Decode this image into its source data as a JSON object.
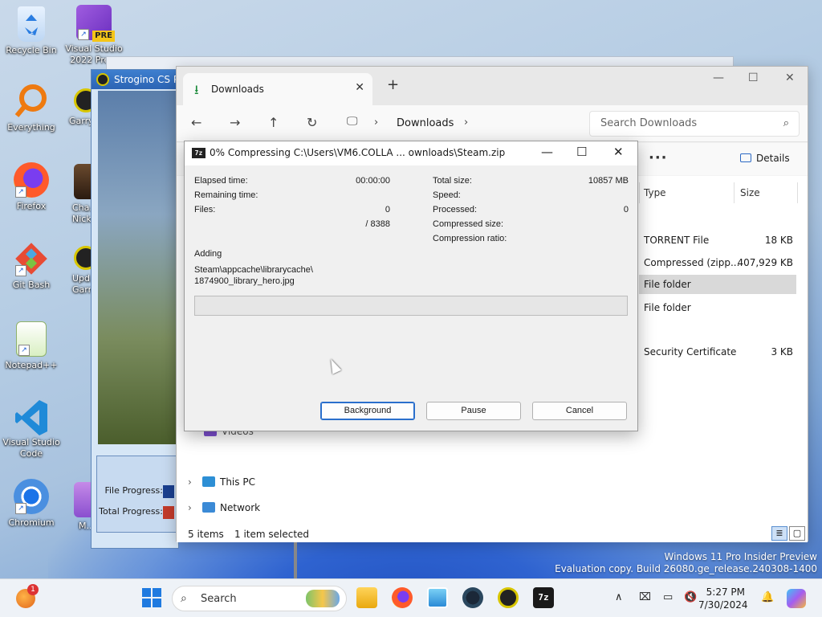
{
  "desktop": {
    "icons": [
      {
        "label": "Recycle Bin",
        "icon": "recycle-bin-icon"
      },
      {
        "label": "Visual Studio 2022 Pre...",
        "icon": "visual-studio-icon",
        "badge": "PRE"
      },
      {
        "label": "Everything",
        "icon": "everything-search-icon"
      },
      {
        "label": "Garry...",
        "icon": "garrys-mod-icon"
      },
      {
        "label": "Firefox",
        "icon": "firefox-icon"
      },
      {
        "label": "Cha... Nick...",
        "icon": "game-character-icon"
      },
      {
        "label": "Git Bash",
        "icon": "git-bash-icon"
      },
      {
        "label": "Upd... Garry...",
        "icon": "garrys-mod-update-icon"
      },
      {
        "label": "Notepad++",
        "icon": "notepad-plus-plus-icon"
      },
      {
        "label": "Visual Studio Code",
        "icon": "vscode-icon"
      },
      {
        "label": "Chromium",
        "icon": "chromium-icon"
      },
      {
        "label": "M...",
        "icon": "app-icon"
      }
    ],
    "watermark": {
      "line1": "Windows 11 Pro Insider Preview",
      "line2": "Evaluation copy. Build 26080.ge_release.240308-1400"
    }
  },
  "cs_window": {
    "title": "Strogino CS P...",
    "file_progress_label": "File Progress:",
    "total_progress_label": "Total Progress:"
  },
  "explorer": {
    "tab_label": "Downloads",
    "breadcrumb": "Downloads",
    "search_placeholder": "Search Downloads",
    "details_label": "Details",
    "columns": {
      "type": "Type",
      "size": "Size"
    },
    "rows": [
      {
        "type": "TORRENT File",
        "size": "18 KB",
        "selected": false
      },
      {
        "type": "Compressed (zipp...",
        "size": "407,929 KB",
        "selected": false
      },
      {
        "type": "File folder",
        "size": "",
        "selected": true
      },
      {
        "type": "File folder",
        "size": "",
        "selected": false
      },
      {
        "type": "Security Certificate",
        "size": "3 KB",
        "selected": false
      }
    ],
    "nav_partial": "Videos",
    "nav_items": [
      {
        "label": "This PC",
        "icon": "this-pc-icon"
      },
      {
        "label": "Network",
        "icon": "network-icon"
      }
    ],
    "status": {
      "items": "5 items",
      "selected": "1 item selected"
    }
  },
  "zip_dialog": {
    "title": "0% Compressing C:\\Users\\VM6.COLLA ... ownloads\\Steam.zip",
    "left": {
      "elapsed_label": "Elapsed time:",
      "elapsed_value": "00:00:00",
      "remaining_label": "Remaining time:",
      "remaining_value": "",
      "files_label": "Files:",
      "files_value": "0",
      "files_total": "/ 8388"
    },
    "right": {
      "total_size_label": "Total size:",
      "total_size_value": "10857 MB",
      "speed_label": "Speed:",
      "speed_value": "",
      "processed_label": "Processed:",
      "processed_value": "0",
      "compressed_size_label": "Compressed size:",
      "compressed_size_value": "",
      "ratio_label": "Compression ratio:",
      "ratio_value": ""
    },
    "action_label": "Adding",
    "current_file_line1": "Steam\\appcache\\librarycache\\",
    "current_file_line2": "1874900_library_hero.jpg",
    "progress_fraction": 0,
    "buttons": {
      "background": "Background",
      "pause": "Pause",
      "cancel": "Cancel"
    }
  },
  "taskbar": {
    "search_label": "Search",
    "notification_badge": "1",
    "time": "5:27 PM",
    "date": "7/30/2024",
    "apps": [
      "start-icon",
      "file-explorer-icon",
      "firefox-icon",
      "photos-icon",
      "steam-icon",
      "garrys-mod-icon",
      "sevenzip-icon"
    ]
  },
  "colors": {
    "accent": "#2a6fcc",
    "selection": "#d9d9d9",
    "taskbar": "#eef2f7"
  }
}
